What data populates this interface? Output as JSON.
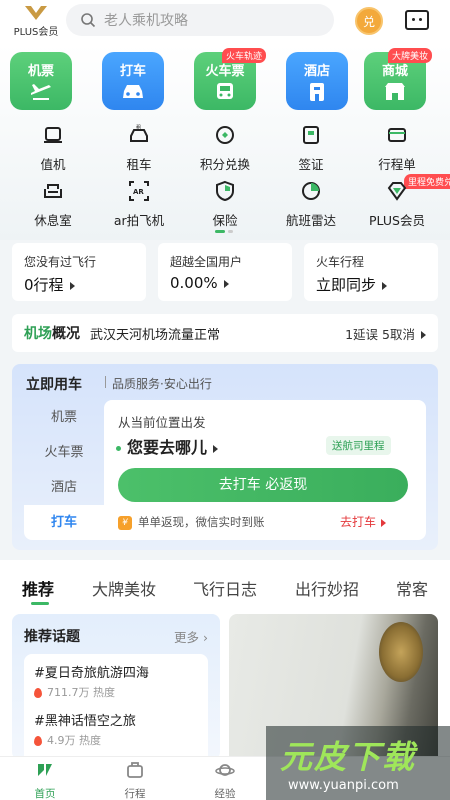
{
  "header": {
    "plus_label": "PLUS会员",
    "search_placeholder": "老人乘机攻略",
    "coin_label": "兑"
  },
  "tiles": [
    {
      "label": "机票",
      "color": "#3cb865"
    },
    {
      "label": "打车",
      "color": "#2f86ef"
    },
    {
      "label": "火车票",
      "color": "#3cb865",
      "badge": "火车轨迹"
    },
    {
      "label": "酒店",
      "color": "#2f86ef"
    },
    {
      "label": "商城",
      "color": "#3cb865",
      "badge": "大牌美妆"
    }
  ],
  "grid_row1": [
    {
      "label": "值机",
      "icon": "seat-icon"
    },
    {
      "label": "租车",
      "icon": "rental-car-icon"
    },
    {
      "label": "积分兑换",
      "icon": "points-exchange-icon"
    },
    {
      "label": "签证",
      "icon": "visa-icon"
    },
    {
      "label": "行程单",
      "icon": "itinerary-icon"
    }
  ],
  "grid_row2": [
    {
      "label": "休息室",
      "icon": "sofa-icon"
    },
    {
      "label": "ar拍飞机",
      "icon": "ar-camera-icon"
    },
    {
      "label": "保险",
      "icon": "shield-icon"
    },
    {
      "label": "航班雷达",
      "icon": "radar-icon"
    },
    {
      "label": "PLUS会员",
      "icon": "diamond-icon",
      "badge": "里程免费兑"
    }
  ],
  "stats": [
    {
      "title": "您没有过飞行",
      "value": "0行程"
    },
    {
      "title": "超越全国用户",
      "value": "0.00%"
    },
    {
      "title": "火车行程",
      "value": "立即同步"
    }
  ],
  "airport": {
    "title_a": "机场",
    "title_b": "概况",
    "status": "武汉天河机场流量正常",
    "stats": "1延误 5取消"
  },
  "car": {
    "title": "立即用车",
    "subtitle": "品质服务·安心出行",
    "tabs": [
      "机票",
      "火车票",
      "酒店",
      "打车"
    ],
    "from": "从当前位置出发",
    "dest": "您要去哪儿",
    "tag": "送航司里程",
    "button": "去打车 必返现",
    "rebate": "单单返现，微信实时到账",
    "link": "去打车"
  },
  "feed": {
    "tabs": [
      "推荐",
      "大牌美妆",
      "飞行日志",
      "出行妙招",
      "常客"
    ],
    "topics_title": "推荐话题",
    "more": "更多",
    "topics": [
      {
        "name": "#夏日奇旅航游四海",
        "heat": "711.7万 热度"
      },
      {
        "name": "#黑神话悟空之旅",
        "heat": "4.9万 热度"
      }
    ]
  },
  "nav": [
    {
      "label": "首页",
      "active": true
    },
    {
      "label": "行程",
      "active": false
    },
    {
      "label": "经验",
      "active": false
    }
  ],
  "watermark": {
    "title": "元皮下载",
    "url": "www.yuanpi.com"
  }
}
